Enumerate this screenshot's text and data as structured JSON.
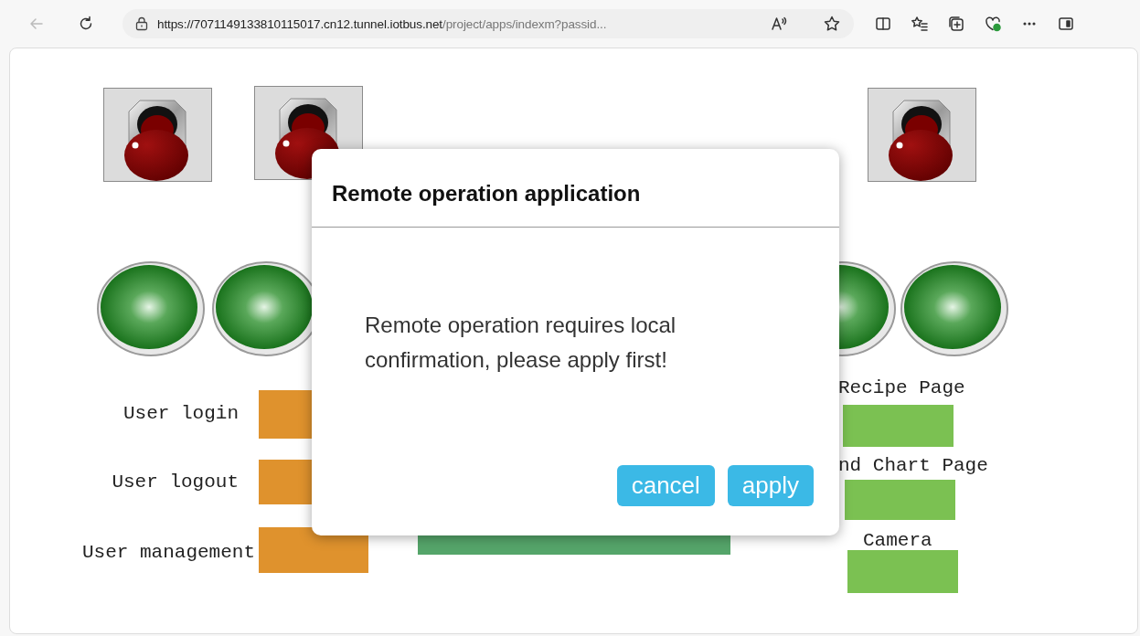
{
  "browser": {
    "back_disabled": true,
    "url_host": "https://7071149133810115017.cn12.tunnel.iotbus.net",
    "url_path": "/project/apps/indexm?passid..."
  },
  "left_buttons": [
    {
      "label": "User login"
    },
    {
      "label": "User logout"
    },
    {
      "label": "User management"
    }
  ],
  "right_buttons": [
    {
      "label": "Recipe Page"
    },
    {
      "label": "nd Chart Page"
    },
    {
      "label": "Camera"
    }
  ],
  "dialog": {
    "title": "Remote operation application",
    "message": "Remote operation requires local confirmation, please apply first!",
    "buttons": [
      "cancel",
      "apply"
    ]
  }
}
